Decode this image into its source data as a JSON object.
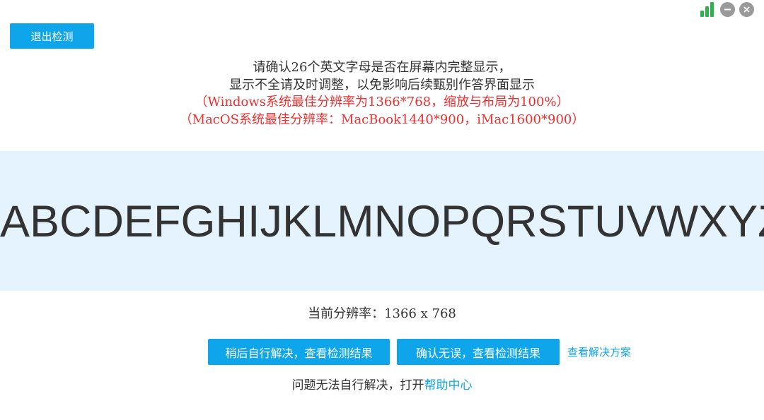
{
  "toolbar": {
    "exit_label": "退出检测"
  },
  "window_controls": {
    "signal_icon": "signal-strength-icon",
    "minimize_icon": "minimize-icon",
    "close_icon": "close-icon",
    "signal_color": "#2bb24c",
    "control_color": "#9a9a9a"
  },
  "notice": {
    "line1": "请确认26个英文字母是否在屏幕内完整显示，",
    "line2": "显示不全请及时调整，以免影响后续甄别作答界面显示",
    "line3": "（Windows系统最佳分辨率为1366*768，缩放与布局为100%）",
    "line4": "（MacOS系统最佳分辨率：MacBook1440*900，iMac1600*900）",
    "warning_color": "#ef2f2f"
  },
  "letters": "ABCDEFGHIJKLMNOPQRSTUVWXYZ",
  "resolution": {
    "label": "当前分辨率：",
    "value": "1366 x 768"
  },
  "actions": {
    "later_label": "稍后自行解决，查看检测结果",
    "confirm_label": "确认无误，查看检测结果",
    "solution_link": "查看解决方案"
  },
  "help": {
    "prefix": "问题无法自行解决，打开",
    "link_label": "帮助中心"
  },
  "accent_color": "#0ea5ea"
}
